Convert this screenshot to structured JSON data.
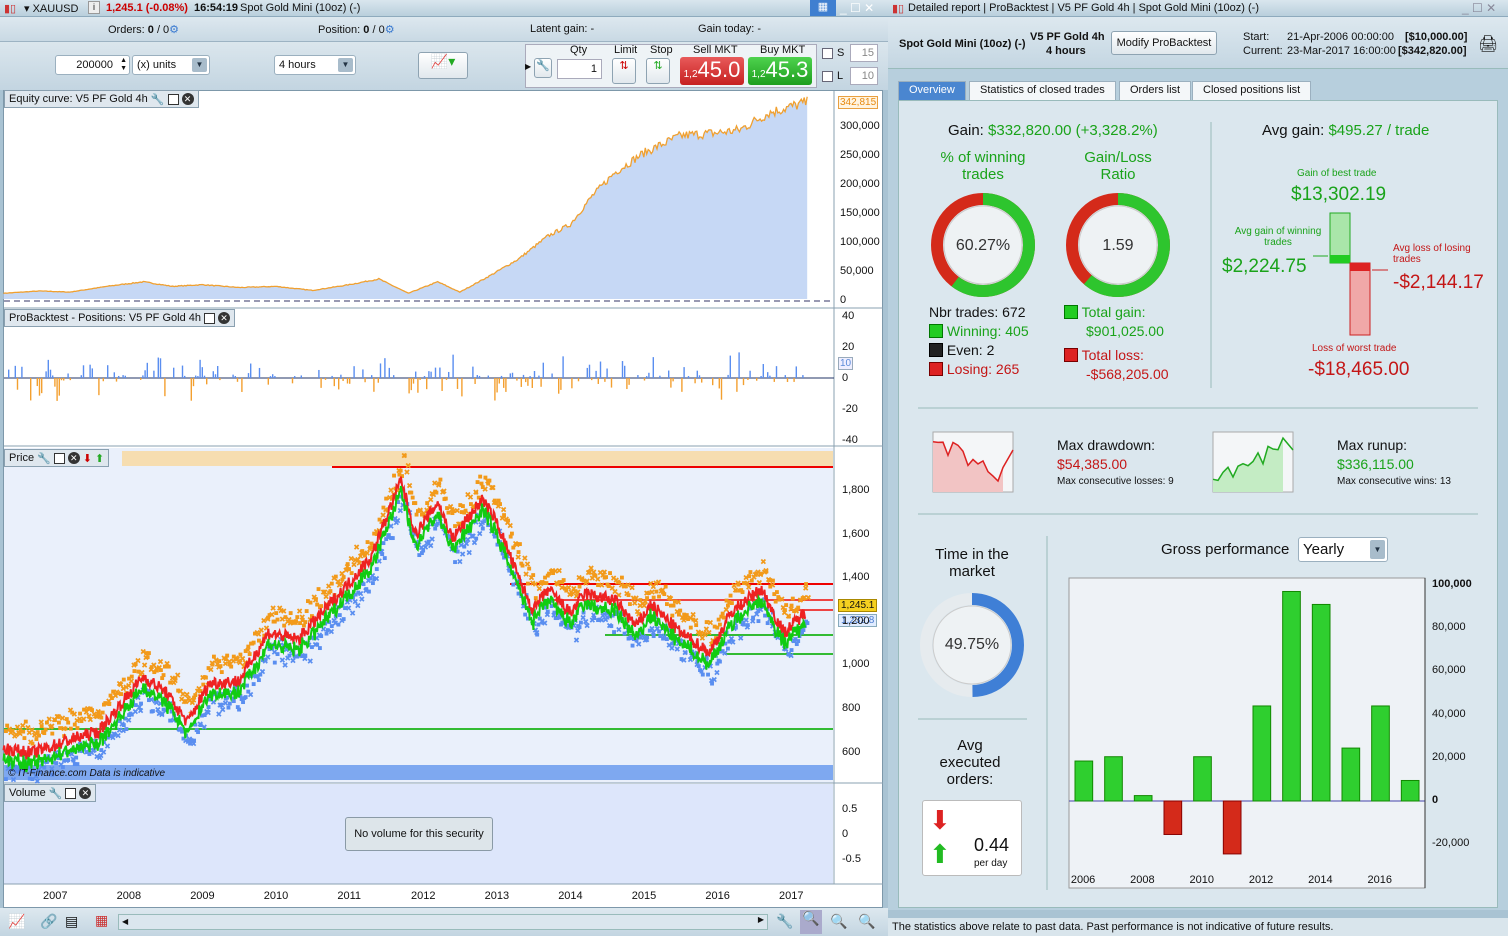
{
  "chart_window": {
    "symbol": "XAUUSD",
    "price_change": "1,245.1 (-0.08%)",
    "time": "16:54:19",
    "instrument": "Spot Gold Mini (10oz) (-)",
    "orders_label": "Orders:",
    "orders_value": "0",
    "orders_total": "/ 0",
    "position_label": "Position:",
    "position_value": "0",
    "position_total": "/ 0",
    "latent_gain": "Latent gain: -",
    "gain_today": "Gain today: -",
    "quantity": "200000",
    "units": "(x) units",
    "timeframe": "4 hours",
    "qty_label": "Qty",
    "qty_value": "1",
    "limit_label": "Limit",
    "stop_label": "Stop",
    "sell_label": "Sell MKT",
    "sell_prefix": "1,2",
    "sell_price": "45.0",
    "buy_label": "Buy MKT",
    "buy_prefix": "1,2",
    "buy_price": "45.3",
    "s_label": "S",
    "s_value": "15",
    "l_label": "L",
    "l_value": "10",
    "equity_title": "Equity curve: V5 PF Gold 4h",
    "equity_last": "342,815",
    "equity_ticks": [
      "300,000",
      "250,000",
      "200,000",
      "150,000",
      "100,000",
      "50,000",
      "0"
    ],
    "positions_title": "ProBacktest - Positions: V5 PF Gold 4h",
    "positions_ticks": [
      "40",
      "20",
      "0",
      "-20",
      "-40"
    ],
    "positions_last": "10",
    "price_title": "Price",
    "price_ticks": [
      "1,800",
      "1,600",
      "1,400",
      "1,200",
      "1,000",
      "800",
      "600"
    ],
    "price_last": "1,245.1",
    "price_prev": "1,232.8",
    "copyright": "© IT-Finance.com Data is indicative",
    "volume_title": "Volume",
    "volume_msg": "No volume for this security",
    "volume_ticks": [
      "0.5",
      "0",
      "-0.5"
    ],
    "years": [
      "2007",
      "2008",
      "2009",
      "2010",
      "2011",
      "2012",
      "2013",
      "2014",
      "2015",
      "2016",
      "2017"
    ]
  },
  "equity_series": [
    [
      2006.3,
      10000
    ],
    [
      2006.8,
      14000
    ],
    [
      2007.2,
      12000
    ],
    [
      2007.7,
      22000
    ],
    [
      2008.2,
      30000
    ],
    [
      2008.6,
      22000
    ],
    [
      2009.0,
      25000
    ],
    [
      2009.5,
      20000
    ],
    [
      2010.0,
      22000
    ],
    [
      2010.5,
      15000
    ],
    [
      2011.0,
      25000
    ],
    [
      2011.4,
      35000
    ],
    [
      2011.8,
      10000
    ],
    [
      2012.2,
      30000
    ],
    [
      2012.5,
      12000
    ],
    [
      2012.9,
      40000
    ],
    [
      2013.3,
      70000
    ],
    [
      2013.7,
      110000
    ],
    [
      2014.0,
      130000
    ],
    [
      2014.3,
      180000
    ],
    [
      2014.6,
      220000
    ],
    [
      2015.0,
      255000
    ],
    [
      2015.5,
      285000
    ],
    [
      2016.0,
      290000
    ],
    [
      2016.3,
      295000
    ],
    [
      2016.7,
      325000
    ],
    [
      2017.2,
      342815
    ]
  ],
  "price_series": [
    [
      2006.3,
      620
    ],
    [
      2006.7,
      600
    ],
    [
      2007.2,
      660
    ],
    [
      2007.6,
      700
    ],
    [
      2008.2,
      950
    ],
    [
      2008.5,
      880
    ],
    [
      2008.8,
      740
    ],
    [
      2009.1,
      920
    ],
    [
      2009.5,
      930
    ],
    [
      2009.9,
      1150
    ],
    [
      2010.3,
      1120
    ],
    [
      2010.6,
      1230
    ],
    [
      2011.0,
      1380
    ],
    [
      2011.3,
      1500
    ],
    [
      2011.7,
      1850
    ],
    [
      2011.9,
      1600
    ],
    [
      2012.2,
      1750
    ],
    [
      2012.4,
      1580
    ],
    [
      2012.8,
      1760
    ],
    [
      2013.0,
      1660
    ],
    [
      2013.3,
      1400
    ],
    [
      2013.5,
      1250
    ],
    [
      2013.7,
      1350
    ],
    [
      2014.0,
      1240
    ],
    [
      2014.2,
      1330
    ],
    [
      2014.6,
      1300
    ],
    [
      2014.9,
      1180
    ],
    [
      2015.1,
      1280
    ],
    [
      2015.5,
      1150
    ],
    [
      2015.9,
      1060
    ],
    [
      2016.2,
      1250
    ],
    [
      2016.6,
      1350
    ],
    [
      2016.9,
      1150
    ],
    [
      2017.2,
      1245
    ]
  ],
  "report": {
    "title": "Detailed report",
    "crumbs": [
      "ProBacktest",
      "V5 PF Gold 4h",
      "Spot Gold Mini (10oz) (-)"
    ],
    "instrument": "Spot Gold Mini (10oz) (-)",
    "system": "V5 PF Gold 4h",
    "timeframe": "4 hours",
    "modify_label": "Modify ProBacktest",
    "start_label": "Start:",
    "start_date": "21-Apr-2006 00:00:00",
    "start_value": "[$10,000.00]",
    "current_label": "Current:",
    "current_date": "23-Mar-2017 16:00:00",
    "current_value": "[$342,820.00]",
    "tabs": [
      "Overview",
      "Statistics of closed trades",
      "Orders list",
      "Closed positions list"
    ],
    "gain_label": "Gain:",
    "gain_value": "$332,820.00 (+3,328.2%)",
    "avg_gain_label": "Avg gain:",
    "avg_gain_value": "$495.27 / trade",
    "winning_title": "% of winning trades",
    "winning_pct": "60.27%",
    "winning_fraction": 0.6027,
    "ratio_title": "Gain/Loss Ratio",
    "ratio_value": "1.59",
    "ratio_fraction": 0.613,
    "nbr_trades": "Nbr trades: 672",
    "winning": "Winning: 405",
    "even": "Even: 2",
    "losing": "Losing: 265",
    "total_gain_label": "Total gain:",
    "total_gain": "$901,025.00",
    "total_loss_label": "Total loss:",
    "total_loss": "-$568,205.00",
    "best_label": "Gain of best trade",
    "best_value": "$13,302.19",
    "avg_win_label": "Avg gain of winning trades",
    "avg_win_value": "$2,224.75",
    "avg_loss_label": "Avg loss of losing trades",
    "avg_loss_value": "-$2,144.17",
    "worst_label": "Loss of worst trade",
    "worst_value": "-$18,465.00",
    "drawdown_label": "Max drawdown:",
    "drawdown_value": "$54,385.00",
    "drawdown_sub": "Max consecutive losses: 9",
    "runup_label": "Max runup:",
    "runup_value": "$336,115.00",
    "runup_sub": "Max consecutive wins: 13",
    "time_label": "Time in the market",
    "time_value": "49.75%",
    "time_fraction": 0.4975,
    "avg_orders_label": "Avg executed orders:",
    "avg_orders_value": "0.44",
    "avg_orders_unit": "per day",
    "gross_label": "Gross performance",
    "gross_period": "Yearly",
    "footer": "The statistics above relate to past data. Past performance is not indicative of future results."
  },
  "chart_data": {
    "type": "bar",
    "title": "Gross performance",
    "period": "Yearly",
    "categories": [
      "2006",
      "2007",
      "2008",
      "2009",
      "2010",
      "2011",
      "2012",
      "2013",
      "2014",
      "2015",
      "2016",
      "2017"
    ],
    "values": [
      18500,
      20500,
      2500,
      -15500,
      20500,
      -24500,
      44000,
      97000,
      91000,
      24500,
      44000,
      9500
    ],
    "x_tick_labels": [
      "2006",
      "2008",
      "2010",
      "2012",
      "2014",
      "2016"
    ],
    "y_tick_labels": [
      "100,000",
      "80,000",
      "60,000",
      "40,000",
      "20,000",
      "0",
      "-20,000"
    ],
    "ylim": [
      -30000,
      100000
    ],
    "colors": {
      "positive": "#2fcf2f",
      "negative": "#d42a1a"
    }
  }
}
